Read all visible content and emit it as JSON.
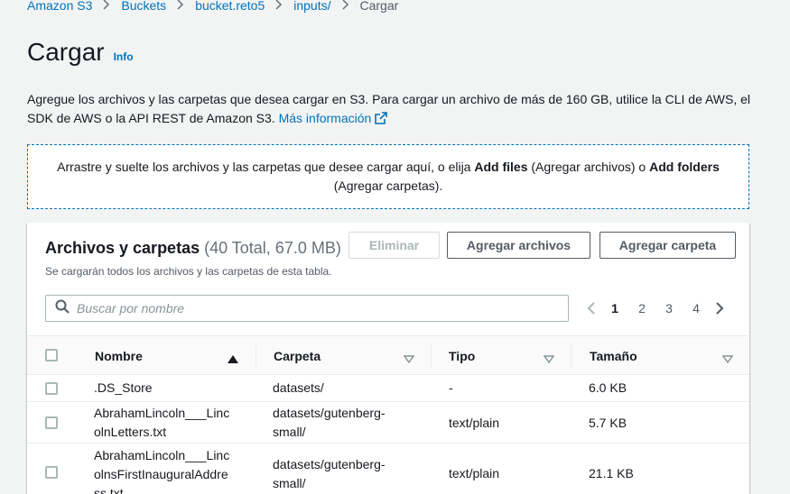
{
  "breadcrumb": {
    "items": [
      "Amazon S3",
      "Buckets",
      "bucket.reto5",
      "inputs/"
    ],
    "current": "Cargar"
  },
  "page": {
    "title": "Cargar",
    "info_link": "Info",
    "description": "Agregue los archivos y las carpetas que desea cargar en S3. Para cargar un archivo de más de 160 GB, utilice la CLI de AWS, el SDK de AWS o la API REST de Amazon S3.",
    "more_info_link": "Más información"
  },
  "dropzone": {
    "text_1": "Arrastre y suelte los archivos y las carpetas que desee cargar aquí, o elija",
    "add_files": "Add files",
    "text_2": "(Agregar archivos) o",
    "add_folders": "Add folders",
    "text_3": "(Agregar carpetas)."
  },
  "files_panel": {
    "title": "Archivos y carpetas",
    "count": "(40 Total, 67.0 MB)",
    "subtitle": "Se cargarán todos los archivos y las carpetas de esta tabla.",
    "remove_button": "Eliminar",
    "add_files_button": "Agregar archivos",
    "add_folder_button": "Agregar carpeta",
    "search_placeholder": "Buscar por nombre",
    "pagination": {
      "pages": [
        "1",
        "2",
        "3",
        "4"
      ],
      "current": "1"
    },
    "columns": {
      "name": "Nombre",
      "folder": "Carpeta",
      "type": "Tipo",
      "size": "Tamaño"
    },
    "rows": [
      {
        "name_lines": [
          ".DS_Store"
        ],
        "folder_lines": [
          "datasets/"
        ],
        "type": "-",
        "size": "6.0 KB"
      },
      {
        "name_lines": [
          "AbrahamLincoln___Linc",
          "olnLetters.txt"
        ],
        "folder_lines": [
          "datasets/gutenberg-",
          "small/"
        ],
        "type": "text/plain",
        "size": "5.7 KB"
      },
      {
        "name_lines": [
          "AbrahamLincoln___Linc",
          "olnsFirstInauguralAddre",
          "ss.txt"
        ],
        "folder_lines": [
          "datasets/gutenberg-",
          "small/"
        ],
        "type": "text/plain",
        "size": "21.1 KB"
      }
    ]
  },
  "colors": {
    "link": "#0073bb",
    "text": "#16191f",
    "muted": "#687078",
    "background": "#f2f3f3"
  }
}
